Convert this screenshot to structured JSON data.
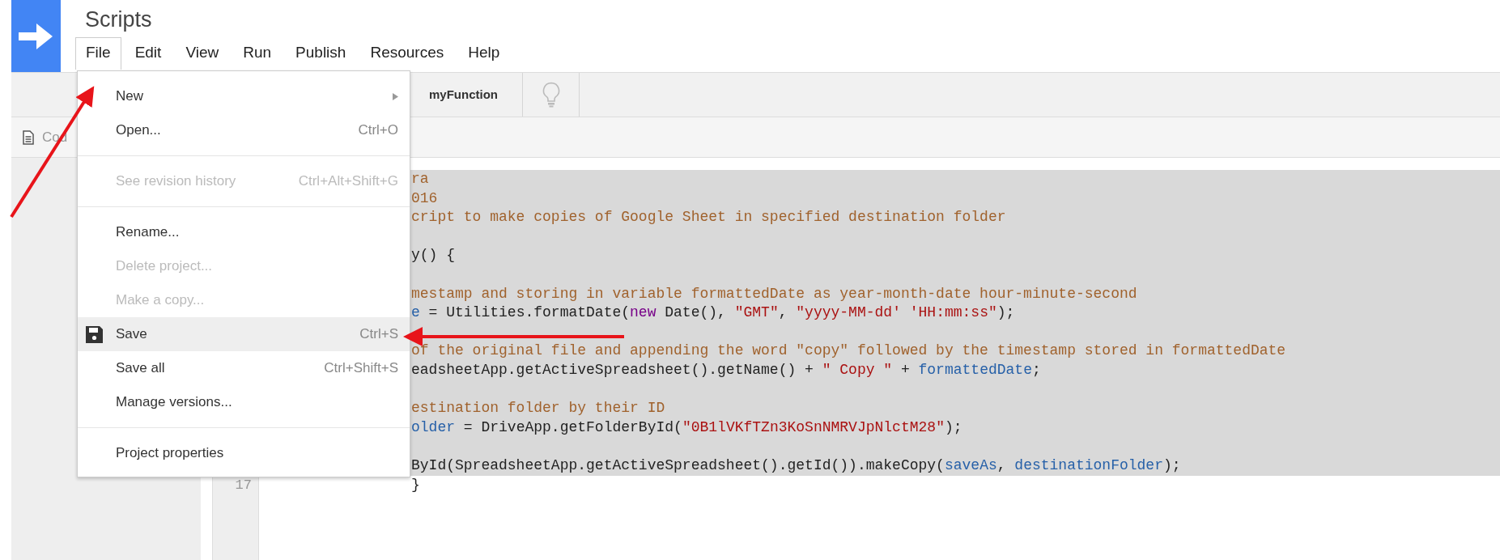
{
  "app": {
    "title": "Scripts"
  },
  "menubar": [
    {
      "label": "File",
      "selected": true
    },
    {
      "label": "Edit",
      "selected": false
    },
    {
      "label": "View",
      "selected": false
    },
    {
      "label": "Run",
      "selected": false
    },
    {
      "label": "Publish",
      "selected": false
    },
    {
      "label": "Resources",
      "selected": false
    },
    {
      "label": "Help",
      "selected": false
    }
  ],
  "toolbar": {
    "function_name": "myFunction"
  },
  "file_tab": {
    "label": "Cod"
  },
  "file_menu": [
    {
      "kind": "item",
      "label": "New",
      "submenu": true,
      "disabled": false,
      "selected": false
    },
    {
      "kind": "item",
      "label": "Open...",
      "shortcut": "Ctrl+O",
      "disabled": false,
      "selected": false
    },
    {
      "kind": "divider"
    },
    {
      "kind": "item",
      "label": "See revision history",
      "shortcut": "Ctrl+Alt+Shift+G",
      "disabled": true,
      "selected": false
    },
    {
      "kind": "divider"
    },
    {
      "kind": "item",
      "label": "Rename...",
      "disabled": false,
      "selected": false
    },
    {
      "kind": "item",
      "label": "Delete project...",
      "disabled": true,
      "selected": false
    },
    {
      "kind": "item",
      "label": "Make a copy...",
      "disabled": true,
      "selected": false
    },
    {
      "kind": "icon_item",
      "label": "Save",
      "shortcut": "Ctrl+S",
      "disabled": false,
      "selected": true
    },
    {
      "kind": "item",
      "label": "Save all",
      "shortcut": "Ctrl+Shift+S",
      "disabled": false,
      "selected": false
    },
    {
      "kind": "item",
      "label": "Manage versions...",
      "disabled": false,
      "selected": false
    },
    {
      "kind": "divider"
    },
    {
      "kind": "item",
      "label": "Project properties",
      "disabled": false,
      "selected": false
    }
  ],
  "editor": {
    "lines": [
      {
        "selected": true,
        "tokens": [
          {
            "kind": "comment",
            "text": "ra"
          }
        ]
      },
      {
        "selected": true,
        "tokens": [
          {
            "kind": "comment",
            "text": "016"
          }
        ]
      },
      {
        "selected": true,
        "tokens": [
          {
            "kind": "comment",
            "text": "cript to make copies of Google Sheet in specified destination folder"
          }
        ]
      },
      {
        "selected": true
      },
      {
        "selected": true,
        "tokens": [
          {
            "kind": "plain",
            "text": "y() {"
          }
        ]
      },
      {
        "selected": true
      },
      {
        "selected": true,
        "tokens": [
          {
            "kind": "comment",
            "text": "mestamp and storing in variable formattedDate as year-month-date hour-minute-second"
          }
        ]
      },
      {
        "selected": true,
        "tokens": [
          {
            "kind": "variable",
            "text": "e"
          },
          {
            "kind": "plain",
            "text": " = Utilities.formatDate("
          },
          {
            "kind": "keyword",
            "text": "new"
          },
          {
            "kind": "plain",
            "text": " Date(), "
          },
          {
            "kind": "string",
            "text": "\"GMT\""
          },
          {
            "kind": "plain",
            "text": ", "
          },
          {
            "kind": "string",
            "text": "\"yyyy-MM-dd' 'HH:mm:ss\""
          },
          {
            "kind": "plain",
            "text": ");"
          }
        ]
      },
      {
        "selected": true
      },
      {
        "selected": true,
        "tokens": [
          {
            "kind": "comment",
            "text": "of the original file and appending the word \"copy\" followed by the timestamp stored in formattedDate"
          }
        ]
      },
      {
        "selected": true,
        "tokens": [
          {
            "kind": "plain",
            "text": "eadsheetApp.getActiveSpreadsheet().getName() + "
          },
          {
            "kind": "string",
            "text": "\" Copy \""
          },
          {
            "kind": "plain",
            "text": " + "
          },
          {
            "kind": "variable",
            "text": "formattedDate"
          },
          {
            "kind": "plain",
            "text": ";"
          }
        ]
      },
      {
        "selected": true
      },
      {
        "selected": true,
        "tokens": [
          {
            "kind": "comment",
            "text": "estination folder by their ID"
          }
        ]
      },
      {
        "selected": true,
        "tokens": [
          {
            "kind": "variable",
            "text": "older"
          },
          {
            "kind": "plain",
            "text": " = DriveApp.getFolderById("
          },
          {
            "kind": "string",
            "text": "\"0B1lVKfTZn3KoSnNMRVJpNlctM28\""
          },
          {
            "kind": "plain",
            "text": ");"
          }
        ]
      },
      {
        "selected": true
      },
      {
        "selected": true,
        "tokens": [
          {
            "kind": "plain",
            "text": "ById(SpreadsheetApp.getActiveSpreadsheet().getId()).makeCopy("
          },
          {
            "kind": "variable",
            "text": "saveAs"
          },
          {
            "kind": "plain",
            "text": ", "
          },
          {
            "kind": "variable",
            "text": "destinationFolder"
          },
          {
            "kind": "plain",
            "text": ");"
          }
        ]
      },
      {
        "selected": false,
        "number": "17",
        "tokens": [
          {
            "kind": "plain",
            "text": "}"
          }
        ]
      }
    ]
  }
}
